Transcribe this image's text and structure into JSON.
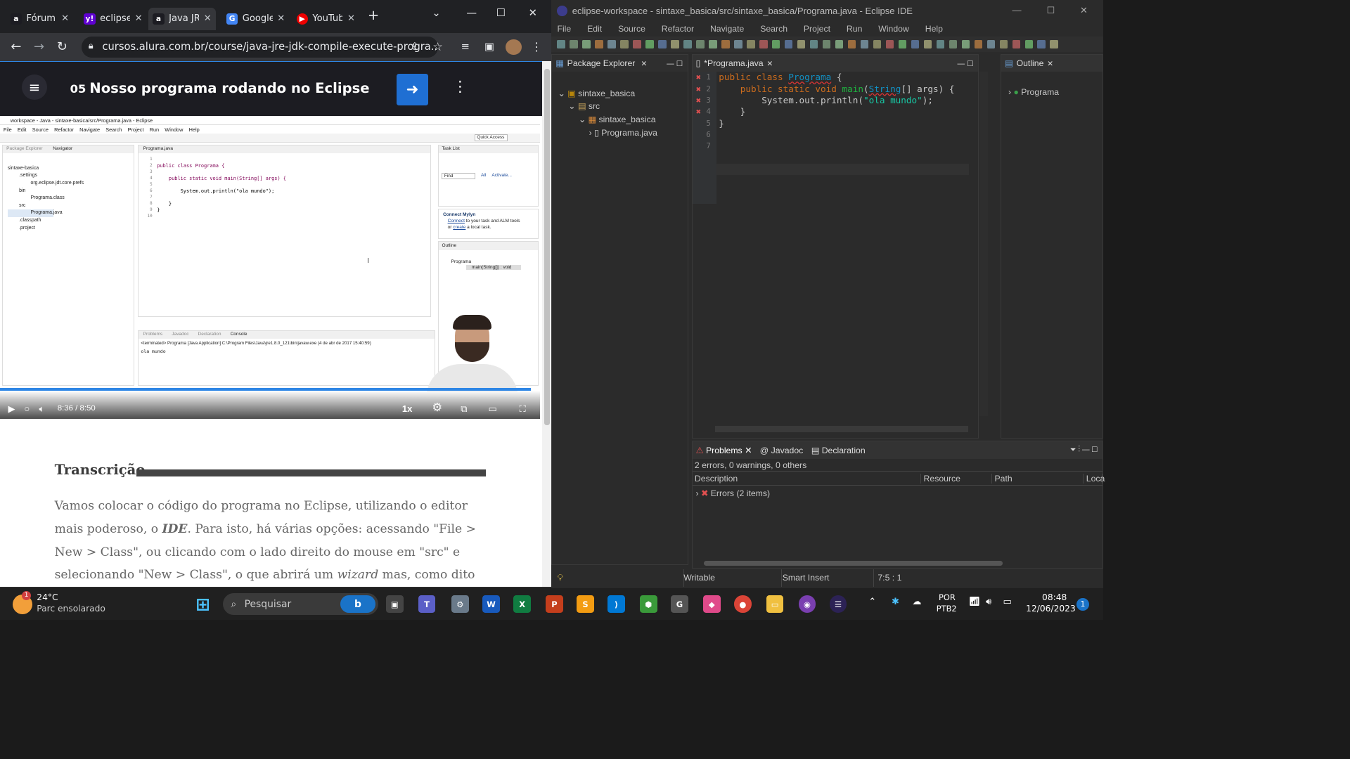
{
  "chrome": {
    "tabs": [
      {
        "label": "Fórum",
        "icon": "alura-icon"
      },
      {
        "label": "eclipse",
        "icon": "yahoo-icon"
      },
      {
        "label": "Java JRE",
        "icon": "alura-icon"
      },
      {
        "label": "Google",
        "icon": "google-translate-icon"
      },
      {
        "label": "YouTube",
        "icon": "youtube-icon"
      }
    ],
    "url": "cursos.alura.com.br/course/java-jre-jdk-compile-execute-progra..."
  },
  "lesson": {
    "number": "05",
    "title": "Nosso programa rodando no Eclipse"
  },
  "video": {
    "current_time": "8:36",
    "separator": "/",
    "duration": "8:50",
    "speed": "1x",
    "progress_fraction": 0.983,
    "inner_eclipse": {
      "title": "workspace - Java - sintaxe-basica/src/Programa.java - Eclipse",
      "menu": [
        "File",
        "Edit",
        "Source",
        "Refactor",
        "Navigate",
        "Search",
        "Project",
        "Run",
        "Window",
        "Help"
      ],
      "quick_access": "Quick Access",
      "left_tabs": [
        "Package Explorer",
        "Navigator"
      ],
      "tree": [
        "sintaxe-basica",
        ".settings",
        "org.eclipse.jdt.core.prefs",
        "bin",
        "Programa.class",
        "src",
        "Programa.java",
        ".classpath",
        ".project"
      ],
      "editor_tab": "Programa.java",
      "code": [
        "",
        "public class Programa {",
        "",
        "    public static void main(String[] args) {",
        "",
        "        System.out.println(\"ola mundo\");",
        "",
        "    }",
        "}",
        ""
      ],
      "task_list": "Task List",
      "find": "Find",
      "all": "All",
      "activate": "Activate...",
      "mylyn_title": "Connect Mylyn",
      "mylyn_text1": "Connect",
      "mylyn_text2": "to your task and ALM tools",
      "mylyn_text3": "or",
      "mylyn_text4": "create",
      "mylyn_text5": "a local task.",
      "outline_tab": "Outline",
      "outline_class": "Programa",
      "outline_method": "main(String[]) : void",
      "bottom_tabs": [
        "Problems",
        "Javadoc",
        "Declaration",
        "Console"
      ],
      "console_line1": "<terminated> Programa [Java Application] C:\\Program Files\\Java\\jre1.8.0_121\\bin\\javaw.exe (4 de abr de 2017 15:40:59)",
      "console_line2": "ola mundo"
    }
  },
  "transcript": {
    "heading": "Transcrição",
    "p1": "Vamos colocar o código do programa no Eclipse, utilizando o editor mais poderoso, o ",
    "p1_em": "IDE",
    "p1b": ". Para isto, há várias opções: acessando \"File > New > Class\", ou clicando com o lado direito do mouse em \"src\" e selecionando \"New > Class\", o que abrirá um ",
    "p1_em2": "wizard",
    "p1c": " mas, como dito anteriormente,"
  },
  "eclipse": {
    "title": "eclipse-workspace - sintaxe_basica/src/sintaxe_basica/Programa.java - Eclipse IDE",
    "menu": [
      "File",
      "Edit",
      "Source",
      "Refactor",
      "Navigate",
      "Search",
      "Project",
      "Run",
      "Window",
      "Help"
    ],
    "package_explorer": "Package Explorer",
    "tree": [
      "sintaxe_basica",
      "src",
      "sintaxe_basica",
      "Programa.java"
    ],
    "editor_tab": "*Programa.java",
    "line_numbers": [
      "1",
      "2",
      "3",
      "4",
      "5",
      "6",
      "7"
    ],
    "outline_tab": "Outline",
    "outline_item": "Programa",
    "problems_tabs": [
      "Problems",
      "Javadoc",
      "Declaration"
    ],
    "problems_summary": "2 errors, 0 warnings, 0 others",
    "columns": [
      "Description",
      "Resource",
      "Path",
      "Loca"
    ],
    "errors_row": "Errors (2 items)",
    "status": [
      "Writable",
      "Smart Insert",
      "7:5 : 1"
    ]
  },
  "taskbar": {
    "weather_temp": "24°C",
    "weather_desc": "Parc ensolarado",
    "weather_badge": "1",
    "search_placeholder": "Pesquisar",
    "lang1": "POR",
    "lang2": "PTB2",
    "time": "08:48",
    "date": "12/06/2023",
    "notif": "1"
  }
}
